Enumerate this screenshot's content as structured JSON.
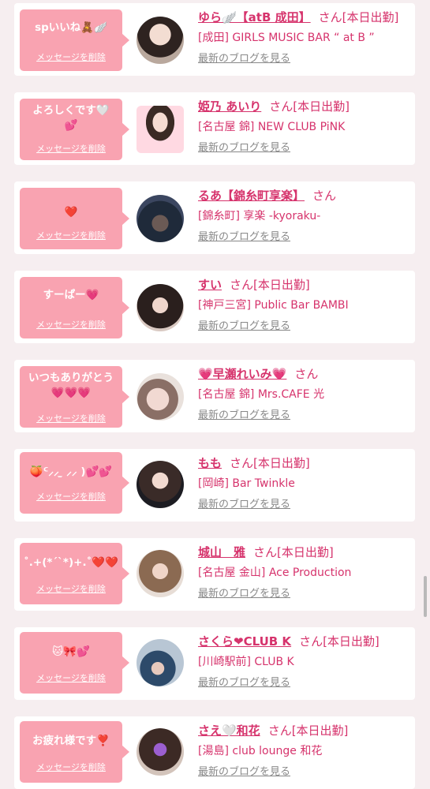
{
  "delete_label": "メッセージを削除",
  "blog_label": "最新のブログを見る",
  "honorific": "さん",
  "today_label": "[本日出勤]",
  "items": [
    {
      "message": "spいいね🧸🪽",
      "name": "ゆら🪽【atB 成田】",
      "shop": "[成田] GIRLS MUSIC BAR “ at B ”",
      "today": true
    },
    {
      "message": "よろしくです🤍\n💕",
      "name": "姫乃 あいり",
      "shop": "[名古屋 錦] NEW CLUB PiNK",
      "today": true
    },
    {
      "message": "❤️",
      "name": "るあ【錦糸町享楽】",
      "shop": "[錦糸町] 享楽 -kyoraku-",
      "today": false
    },
    {
      "message": "すーぱー💗",
      "name": "すい",
      "shop": "[神戸三宮] Public Bar BAMBI",
      "today": true
    },
    {
      "message": "いつもありがとう\n💗💗💗",
      "name": "💗早瀬れいみ💗",
      "shop": "[名古屋 錦] Mrs.CAFE 光",
      "today": false
    },
    {
      "message": "🍑ᑦ⸝⸝ ̫ ⸝⸝ )💕💕",
      "name": "もも",
      "shop": "[岡崎] Bar Twinkle",
      "today": true
    },
    {
      "message": "˚.+(*ˊˋ*)+.˚❤️❤️",
      "name": "城山　雅",
      "shop": "[名古屋 金山] Ace Production",
      "today": true
    },
    {
      "message": "🐱🎀💕",
      "name": "さくら❤CLUB K",
      "shop": "[川崎駅前] CLUB K",
      "today": true
    },
    {
      "message": "お疲れ様です❣️",
      "name": "さえ🤍和花",
      "shop": "[湯島] club lounge 和花",
      "today": true
    }
  ]
}
